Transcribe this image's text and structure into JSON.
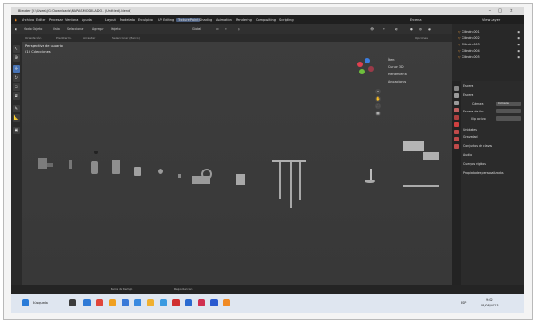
{
  "window": {
    "title": "Blender [C:\\Users\\(G:\\Downloads\\MAPAS MODELADO - (Untitled).blend]"
  },
  "menu": {
    "items": [
      "Archivo",
      "Editar",
      "Procesar",
      "Ventana",
      "Ayuda"
    ],
    "workspace_tabs": [
      "Layout",
      "Modelado",
      "Esculpido",
      "UV Editing",
      "Texture Paint",
      "Shading",
      "Animation",
      "Rendering",
      "Compositing",
      "Scripting"
    ],
    "active_tab": "Texture Paint",
    "scene_label": "Escena",
    "view_layer_label": "View Layer"
  },
  "header": {
    "mode": "Modo Objeto",
    "view": "Vista",
    "select": "Seleccionar",
    "add": "Agregar",
    "object": "Objeto",
    "transform": "Global",
    "options": "Opciones"
  },
  "subheader": {
    "items": [
      "Orientación",
      "Predeterm.",
      "Arrastrar",
      "Seleccionar (Marco)"
    ]
  },
  "viewport": {
    "overlay_line1": "Perspectiva de usuario",
    "overlay_line2": "(1) Colecciones",
    "npanel_items": [
      "Ítem",
      "Cursor 3D",
      "Herramienta",
      "Anotaciones"
    ]
  },
  "outliner": {
    "rows": [
      {
        "name": "Cilindro.001",
        "icon": "triangle-icon"
      },
      {
        "name": "Cilindro.002",
        "icon": "triangle-icon"
      },
      {
        "name": "Cilindro.003",
        "icon": "triangle-icon"
      },
      {
        "name": "Cilindro.004",
        "icon": "triangle-icon"
      },
      {
        "name": "Cilindro.005",
        "icon": "triangle-icon"
      }
    ]
  },
  "properties": {
    "title": "Escena",
    "section": "Escena",
    "camera_label": "Cámara",
    "camera_value": "Cámara",
    "background_label": "Escena de fon",
    "clip_label": "Clip activo",
    "units_label": "Unidades",
    "gravity_label": "Gravedad",
    "sections": [
      "Conjuntos de claves",
      "Audio",
      "Cuerpos rígidos",
      "Propiedades personalizadas"
    ]
  },
  "timeline": {
    "left": "Barra de tiempo",
    "right": "Reproducción"
  },
  "taskbar": {
    "search": "Búsqueda",
    "time": "9:02",
    "date": "08/08/2023",
    "lang": "ESP"
  }
}
